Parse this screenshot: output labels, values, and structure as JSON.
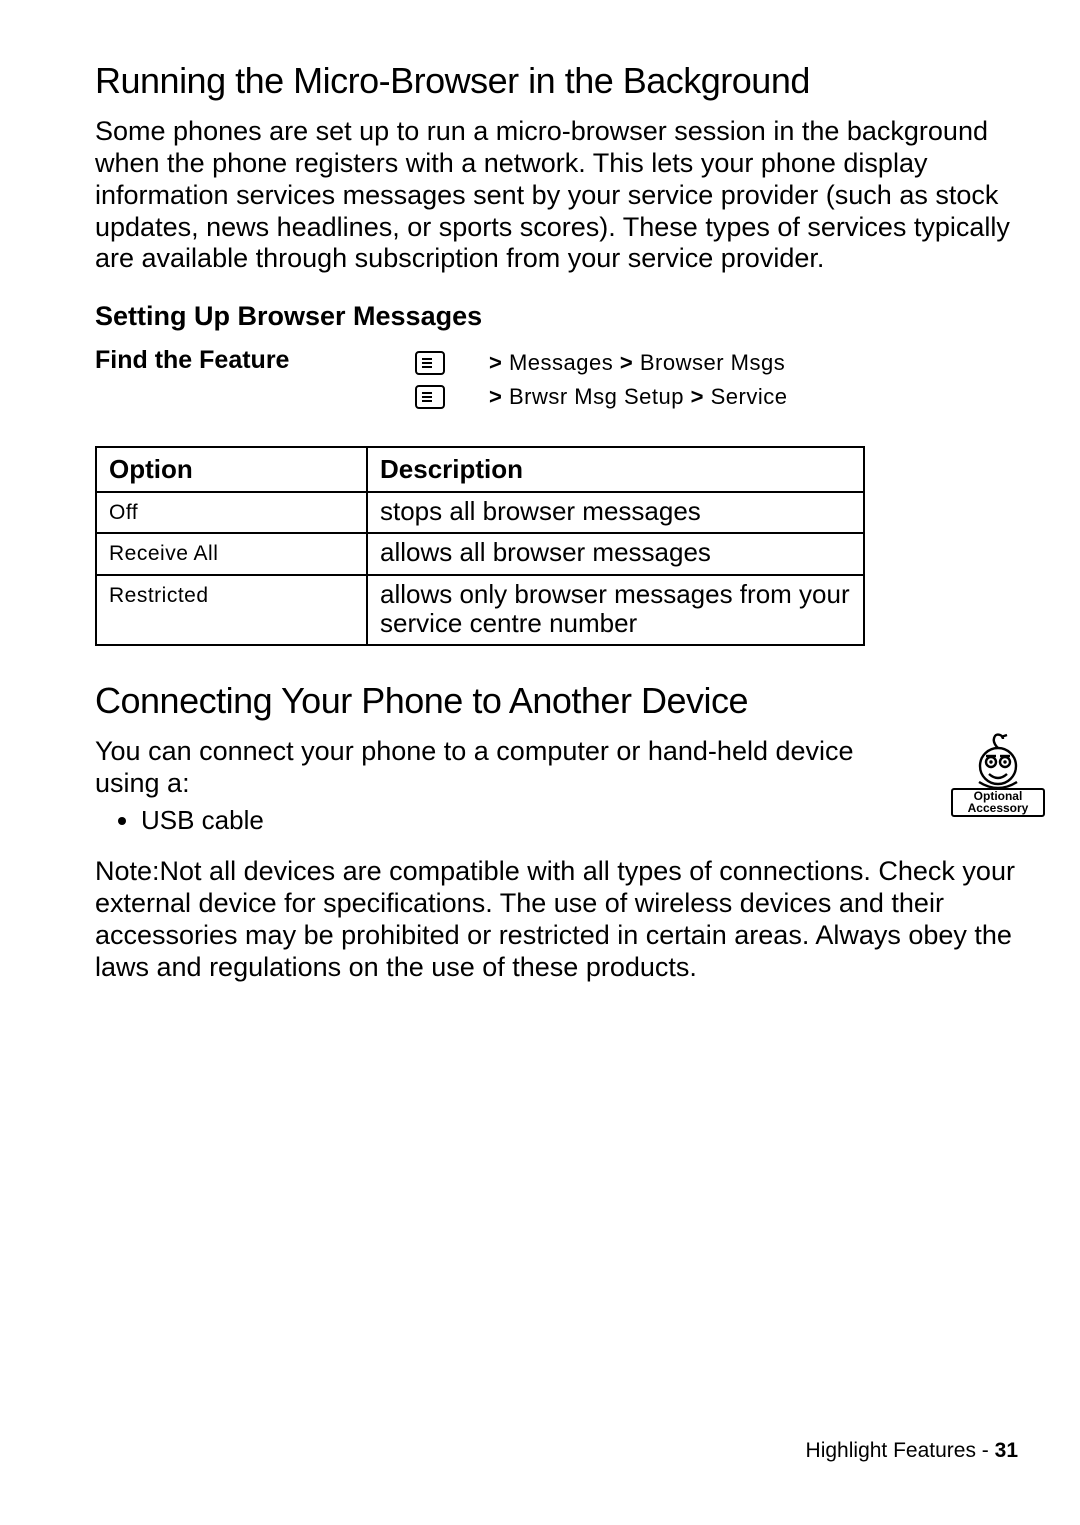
{
  "section1": {
    "title": "Running the Micro-Browser in the Background",
    "body": "Some phones are set up to run a micro-browser session in the background when the phone registers with a network. This lets your phone display information services messages sent by your service provider (such as stock updates, news headlines, or sports scores). These types of services typically are available through subscription from your service provider."
  },
  "sub1": {
    "title": "Setting Up Browser Messages",
    "feature_label": "Find the Feature",
    "path1_a": "Messages",
    "path1_b": "Browser Msgs",
    "path2_a": "Brwsr Msg Setup",
    "path2_b": "Service",
    "gt": ">"
  },
  "table": {
    "col1": "Option",
    "col2": "Description",
    "rows": [
      {
        "opt": "Off",
        "desc": "stops all browser messages"
      },
      {
        "opt": "Receive All",
        "desc": "allows all browser messages"
      },
      {
        "opt": "Restricted",
        "desc": "allows only browser messages from your service centre number"
      }
    ]
  },
  "section2": {
    "title": "Connecting Your Phone to Another Device",
    "lead": "You can connect your phone to a computer or hand-held device using a:",
    "bullets": [
      "USB cable"
    ],
    "note": "Note:Not all devices are compatible with all types of connections. Check your external device for specifications. The use of wireless devices and their accessories may be prohibited or restricted in certain areas. Always obey the laws and regulations on the use of these products."
  },
  "accessory": {
    "line1": "Optional",
    "line2": "Accessory"
  },
  "footer": {
    "text": "Highlight Features - ",
    "page": "31"
  }
}
